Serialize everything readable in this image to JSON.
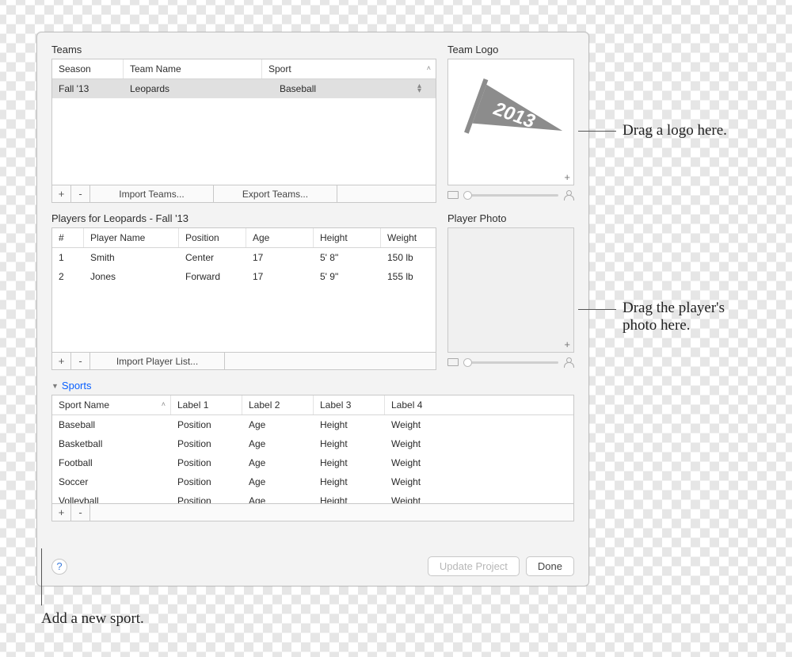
{
  "teams": {
    "label": "Teams",
    "columns": {
      "season": "Season",
      "team_name": "Team Name",
      "sport": "Sport"
    },
    "rows": [
      {
        "season": "Fall '13",
        "team_name": "Leopards",
        "sport": "Baseball"
      }
    ],
    "buttons": {
      "add": "+",
      "remove": "-",
      "import": "Import Teams...",
      "export": "Export Teams..."
    }
  },
  "team_logo": {
    "label": "Team Logo",
    "add": "+",
    "pennant_text": "2013"
  },
  "players": {
    "label": "Players for Leopards - Fall '13",
    "columns": {
      "num": "#",
      "name": "Player Name",
      "position": "Position",
      "age": "Age",
      "height": "Height",
      "weight": "Weight"
    },
    "rows": [
      {
        "num": "1",
        "name": "Smith",
        "position": "Center",
        "age": "17",
        "height": "5' 8\"",
        "weight": "150 lb"
      },
      {
        "num": "2",
        "name": "Jones",
        "position": "Forward",
        "age": "17",
        "height": "5' 9\"",
        "weight": "155 lb"
      }
    ],
    "buttons": {
      "add": "+",
      "remove": "-",
      "import": "Import Player List..."
    }
  },
  "player_photo": {
    "label": "Player Photo",
    "add": "+"
  },
  "sports": {
    "label": "Sports",
    "columns": {
      "name": "Sport Name",
      "l1": "Label 1",
      "l2": "Label 2",
      "l3": "Label 3",
      "l4": "Label 4"
    },
    "rows": [
      {
        "name": "Baseball",
        "l1": "Position",
        "l2": "Age",
        "l3": "Height",
        "l4": "Weight"
      },
      {
        "name": "Basketball",
        "l1": "Position",
        "l2": "Age",
        "l3": "Height",
        "l4": "Weight"
      },
      {
        "name": "Football",
        "l1": "Position",
        "l2": "Age",
        "l3": "Height",
        "l4": "Weight"
      },
      {
        "name": "Soccer",
        "l1": "Position",
        "l2": "Age",
        "l3": "Height",
        "l4": "Weight"
      },
      {
        "name": "Volleyball",
        "l1": "Position",
        "l2": "Age",
        "l3": "Height",
        "l4": "Weight"
      }
    ],
    "buttons": {
      "add": "+",
      "remove": "-"
    }
  },
  "footer": {
    "help": "?",
    "update": "Update Project",
    "done": "Done"
  },
  "callouts": {
    "logo": "Drag a logo here.",
    "photo_l1": "Drag the player's",
    "photo_l2": "photo here.",
    "sport": "Add a new sport."
  }
}
